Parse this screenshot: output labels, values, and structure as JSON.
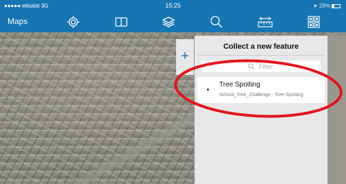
{
  "status_bar": {
    "carrier": "●●●●● etisalat  3G",
    "time": "15:25",
    "battery": "28%"
  },
  "nav": {
    "maps_label": "Maps",
    "icons": [
      "location-target-icon",
      "book-icon",
      "layers-icon",
      "search-icon",
      "measure-icon",
      "qr-grid-icon"
    ]
  },
  "add_button": {
    "label": "+"
  },
  "panel": {
    "title": "Collect a new feature",
    "filter_placeholder": "Filter",
    "features": [
      {
        "name": "Tree Spotting",
        "subtitle": "School_Tree_Challenge - Tree Spotting"
      }
    ]
  },
  "colors": {
    "header": "#1675b2",
    "panel": "#e8e8e8",
    "annotation": "#e2141c"
  }
}
